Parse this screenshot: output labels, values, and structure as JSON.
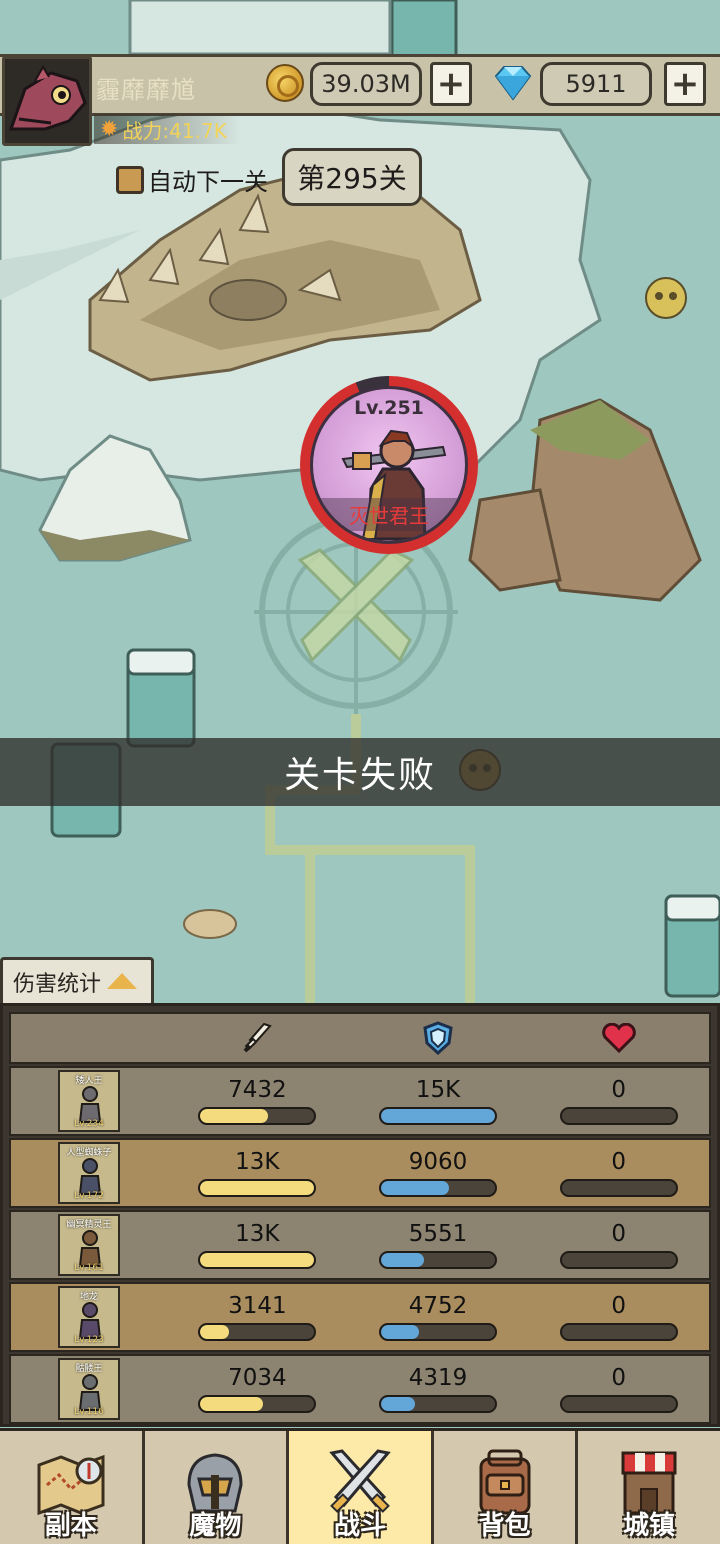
{
  "player": {
    "name": "霾靡靡馗",
    "power_label": "战力:41.7K"
  },
  "currency": {
    "gold": "39.03M",
    "gems": "5911",
    "plus": "+"
  },
  "stage": {
    "auto_next_label": "自动下一关",
    "current": "第295关"
  },
  "boss": {
    "level": "Lv.251",
    "name": "灭世君王",
    "hp_fraction": 0.94
  },
  "result_banner": "关卡失败",
  "damage_stats": {
    "tab_label": "伤害统计",
    "columns": [
      "attack-icon",
      "defense-icon",
      "heal-icon"
    ],
    "rows": [
      {
        "name": "矮人王",
        "level": "Lv.234",
        "atk": "7432",
        "atk_fraction": 0.59,
        "def": "15K",
        "def_fraction": 1.0,
        "hp": "0",
        "hp_fraction": 0
      },
      {
        "name": "人型蜘蛛子",
        "level": "Lv.172",
        "atk": "13K",
        "atk_fraction": 1.0,
        "def": "9060",
        "def_fraction": 0.6,
        "hp": "0",
        "hp_fraction": 0
      },
      {
        "name": "幽冥精灵王",
        "level": "Lv.161",
        "atk": "13K",
        "atk_fraction": 1.0,
        "def": "5551",
        "def_fraction": 0.38,
        "hp": "0",
        "hp_fraction": 0
      },
      {
        "name": "地龙",
        "level": "Lv.123",
        "atk": "3141",
        "atk_fraction": 0.25,
        "def": "4752",
        "def_fraction": 0.33,
        "hp": "0",
        "hp_fraction": 0
      },
      {
        "name": "骷髅王",
        "level": "Lv.116",
        "atk": "7034",
        "atk_fraction": 0.55,
        "def": "4319",
        "def_fraction": 0.3,
        "hp": "0",
        "hp_fraction": 0
      }
    ]
  },
  "nav": [
    {
      "label": "副本",
      "icon": "map-icon",
      "active": false
    },
    {
      "label": "魔物",
      "icon": "monster-helmet-icon",
      "active": false
    },
    {
      "label": "战斗",
      "icon": "crossed-swords-icon",
      "active": true
    },
    {
      "label": "背包",
      "icon": "backpack-icon",
      "active": false
    },
    {
      "label": "城镇",
      "icon": "town-shop-icon",
      "active": false
    }
  ],
  "colors": {
    "atk_bar": "#f4dc7e",
    "def_bar": "#63a7d8",
    "boss_ring": "#d32f2f",
    "active_tab": "#fde9a8"
  }
}
